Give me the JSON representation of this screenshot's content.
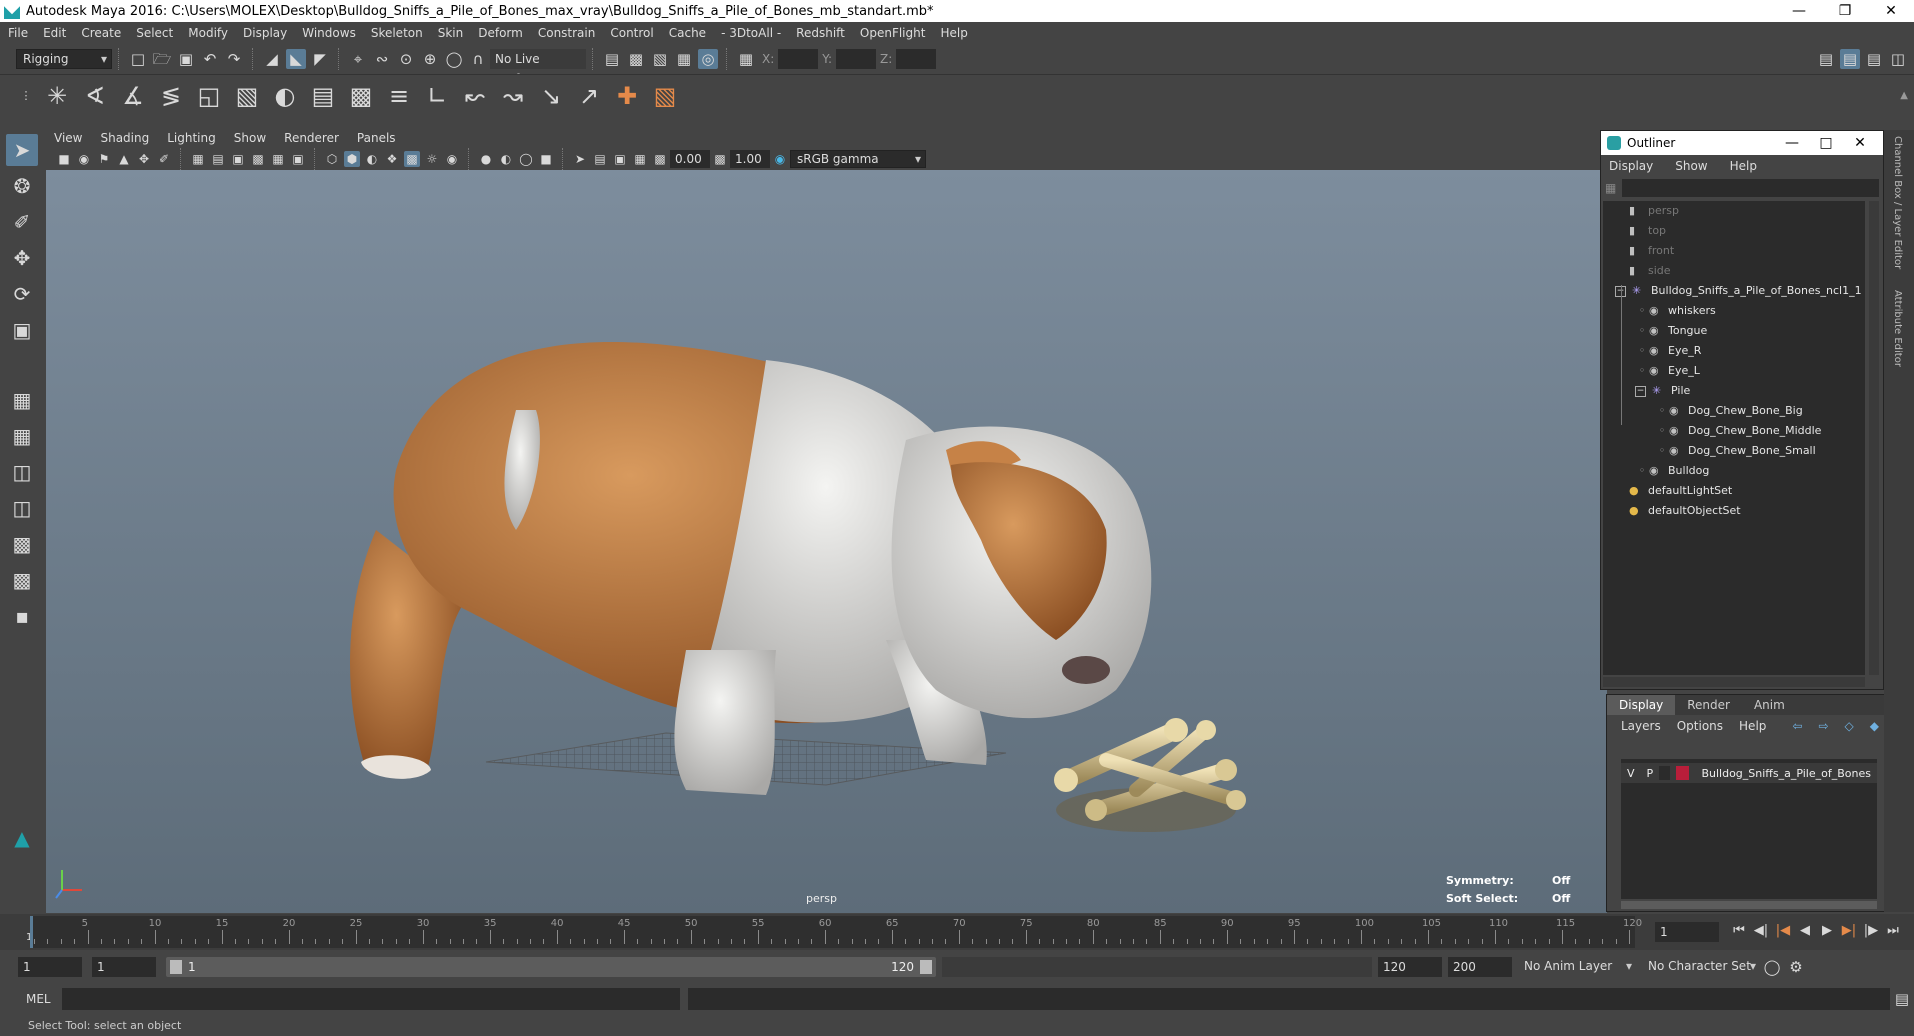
{
  "window": {
    "title": "Autodesk Maya 2016: C:\\Users\\MOLEX\\Desktop\\Bulldog_Sniffs_a_Pile_of_Bones_max_vray\\Bulldog_Sniffs_a_Pile_of_Bones_mb_standart.mb*",
    "minimize": "—",
    "restore": "❐",
    "close": "✕"
  },
  "menubar": [
    "File",
    "Edit",
    "Create",
    "Select",
    "Modify",
    "Display",
    "Windows",
    "Skeleton",
    "Skin",
    "Deform",
    "Constrain",
    "Control",
    "Cache",
    "- 3DtoAll -",
    "Redshift",
    "OpenFlight",
    "Help"
  ],
  "shelf": {
    "mode": "Rigging",
    "live_surface": "No Live Surface",
    "x_label": "X:",
    "y_label": "Y:",
    "z_label": "Z:"
  },
  "viewport": {
    "menu": [
      "View",
      "Shading",
      "Lighting",
      "Show",
      "Renderer",
      "Panels"
    ],
    "exposure": "0.00",
    "gamma": "1.00",
    "color_space": "sRGB gamma",
    "camera": "persp",
    "symmetry_label": "Symmetry:",
    "symmetry_value": "Off",
    "soft_select_label": "Soft Select:",
    "soft_select_value": "Off"
  },
  "outliner": {
    "title": "Outliner",
    "menu": [
      "Display",
      "Show",
      "Help"
    ],
    "items": [
      {
        "label": "persp",
        "icon": "camera-icon",
        "depth": 0,
        "dim": true
      },
      {
        "label": "top",
        "icon": "camera-icon",
        "depth": 0,
        "dim": true
      },
      {
        "label": "front",
        "icon": "camera-icon",
        "depth": 0,
        "dim": true
      },
      {
        "label": "side",
        "icon": "camera-icon",
        "depth": 0,
        "dim": true
      },
      {
        "label": "Bulldog_Sniffs_a_Pile_of_Bones_ncl1_1",
        "icon": "group-icon",
        "depth": 0,
        "expand": "−"
      },
      {
        "label": "whiskers",
        "icon": "mesh-icon",
        "depth": 1
      },
      {
        "label": "Tongue",
        "icon": "mesh-icon",
        "depth": 1
      },
      {
        "label": "Eye_R",
        "icon": "mesh-icon",
        "depth": 1
      },
      {
        "label": "Eye_L",
        "icon": "mesh-icon",
        "depth": 1
      },
      {
        "label": "Pile",
        "icon": "group-icon",
        "depth": 1,
        "expand": "−"
      },
      {
        "label": "Dog_Chew_Bone_Big",
        "icon": "mesh-icon",
        "depth": 2
      },
      {
        "label": "Dog_Chew_Bone_Middle",
        "icon": "mesh-icon",
        "depth": 2
      },
      {
        "label": "Dog_Chew_Bone_Small",
        "icon": "mesh-icon",
        "depth": 2
      },
      {
        "label": "Bulldog",
        "icon": "mesh-icon",
        "depth": 1
      },
      {
        "label": "defaultLightSet",
        "icon": "set-icon",
        "depth": 0
      },
      {
        "label": "defaultObjectSet",
        "icon": "set-icon",
        "depth": 0
      }
    ]
  },
  "channel": {
    "tabs": [
      "Display",
      "Render",
      "Anim"
    ],
    "menu": [
      "Layers",
      "Options",
      "Help"
    ],
    "layer": {
      "v": "V",
      "p": "P",
      "name": "Bulldog_Sniffs_a_Pile_of_Bones",
      "color": "#b91e3a"
    }
  },
  "right_strip": {
    "channel_box": "Channel Box / Layer Editor",
    "attribute": "Attribute Editor"
  },
  "timeline": {
    "ticks": [
      "5",
      "10",
      "15",
      "20",
      "25",
      "30",
      "35",
      "40",
      "45",
      "50",
      "55",
      "60",
      "65",
      "70",
      "75",
      "80",
      "85",
      "90",
      "95",
      "100",
      "105",
      "110",
      "115",
      "120"
    ],
    "start_tick": "1",
    "current_frame": "1"
  },
  "range": {
    "start": "1",
    "playback_start": "1",
    "slider_start": "1",
    "slider_end": "120",
    "playback_end": "120",
    "end": "200",
    "anim_layer": "No Anim Layer",
    "char_set": "No Character Set"
  },
  "cmd": {
    "label": "MEL"
  },
  "status": {
    "text": "Select Tool: select an object"
  }
}
